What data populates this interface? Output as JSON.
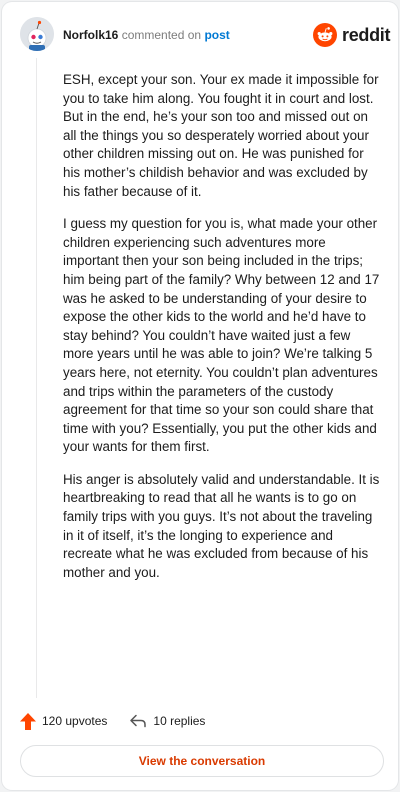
{
  "header": {
    "username": "Norfolk16",
    "commented_text": "commented on",
    "post_link": "post",
    "logo_text": "reddit"
  },
  "comment": {
    "paragraphs": [
      "ESH, except your son. Your ex made it impossible for you to take him along. You fought it in court and lost. But in the end, he’s your son too and missed out on all the things you so desperately worried about your other children missing out on. He was punished for his mother’s childish behavior and was excluded by his father because of it.",
      "I guess my question for you is, what made your other children experiencing such adventures more important then your son being included in the trips; him being part of the family? Why between 12 and 17 was he asked to be understanding of your desire to expose the other kids to the world and he’d have to stay behind? You couldn’t have waited just a few more years until he was able to join? We’re talking 5 years here, not eternity. You couldn’t plan adventures and trips within the parameters of the custody agreement for that time so your son could share that time with you? Essentially, you put the other kids and your wants for them first.",
      "His anger is absolutely valid and understandable. It is heartbreaking to read that all he wants is to go on family trips with you guys. It’s not about the traveling in it of itself, it’s the longing to experience and recreate what he was excluded from because of his mother and you."
    ]
  },
  "footer": {
    "upvotes": "120 upvotes",
    "replies": "10 replies",
    "view_button": "View the conversation"
  },
  "colors": {
    "brand": "#ff4500",
    "link": "#0079d3",
    "button_text": "#d93a00"
  },
  "icons": {
    "avatar": "snoo-avatar",
    "logo": "reddit-snoo-icon",
    "upvote": "upvote-arrow-icon",
    "reply": "reply-arrow-icon"
  }
}
